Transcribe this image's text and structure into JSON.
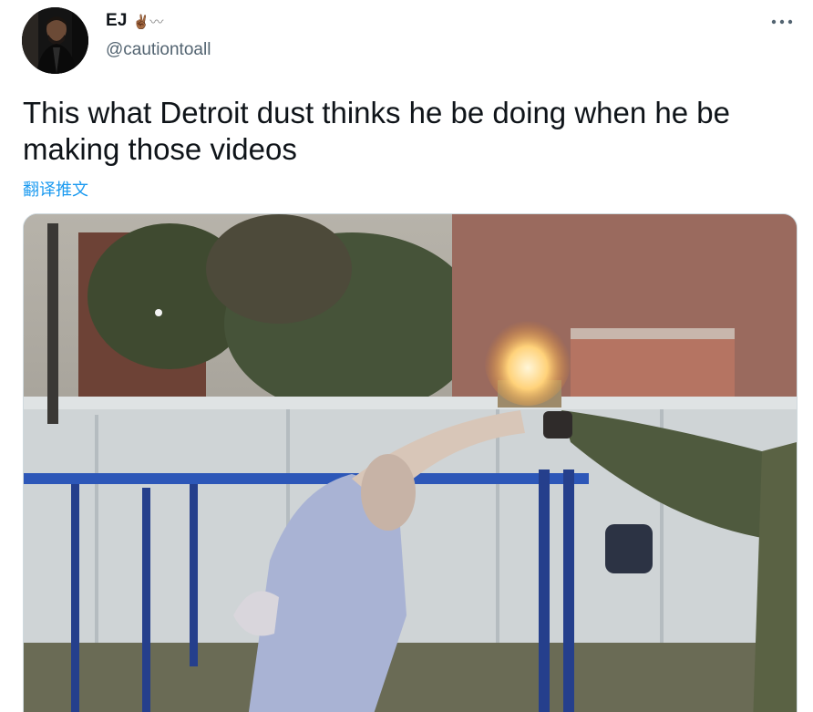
{
  "author": {
    "display_name": "EJ",
    "name_emoji": "✌🏾〰",
    "handle": "@cautiontoall"
  },
  "tweet": {
    "text": "This what Detroit dust thinks he be doing when he be making those videos",
    "translate_label": "翻译推文"
  },
  "icons": {
    "more": "more-horizontal-icon",
    "avatar": "avatar-photo"
  },
  "colors": {
    "text_primary": "#0f1419",
    "text_secondary": "#536471",
    "link": "#1d9bf0",
    "border": "#cfd9de"
  }
}
